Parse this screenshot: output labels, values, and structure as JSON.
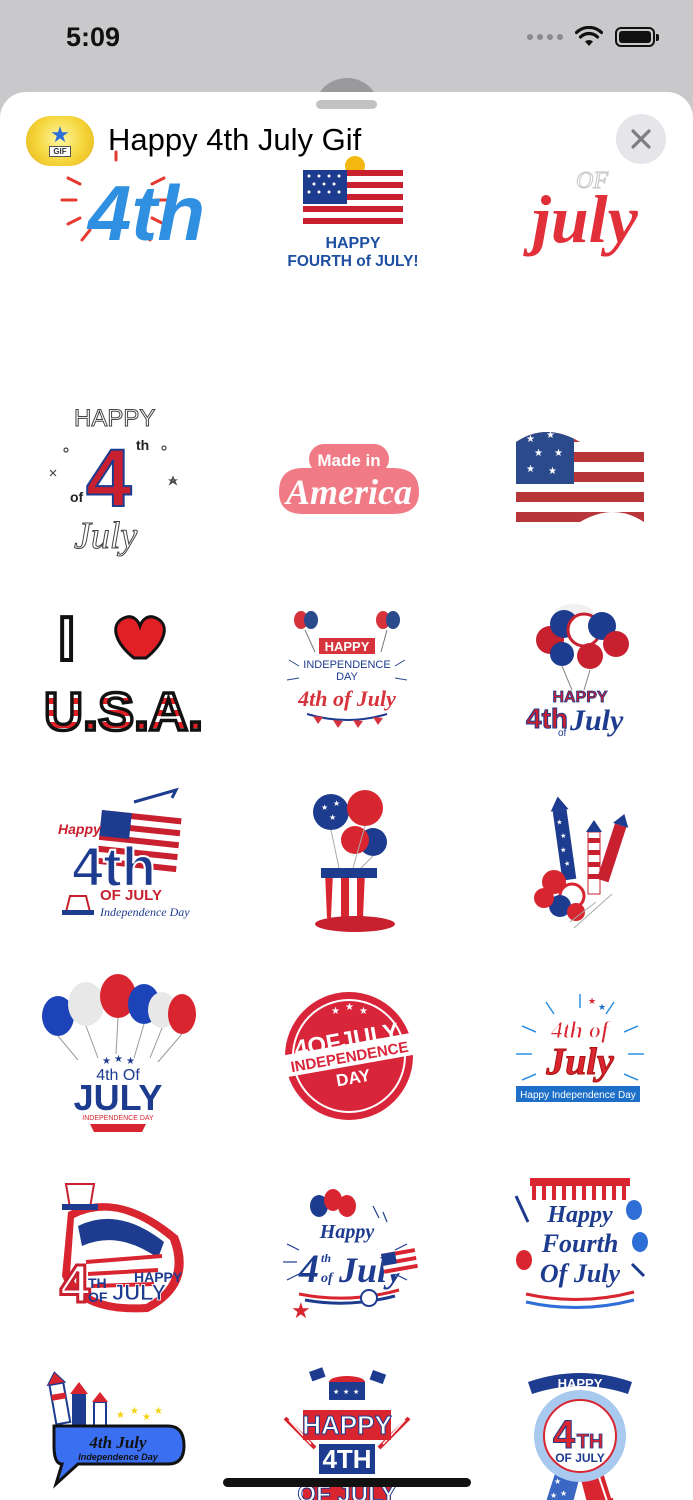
{
  "status_bar": {
    "time": "5:09"
  },
  "header": {
    "title": "Happy 4th July Gif",
    "app_icon_label": "GIF"
  },
  "colors": {
    "red": "#d9252f",
    "blue": "#1d3b8f",
    "light_blue": "#2f8fe0",
    "sheet_bg": "#ffffff",
    "backdrop": "#c9c9cb"
  },
  "stickers": [
    {
      "name": "4th-blue",
      "text": "4th"
    },
    {
      "name": "flag-happy-fourth",
      "line1": "HAPPY",
      "line2": "FOURTH of JULY!"
    },
    {
      "name": "of-july-script",
      "line1": "OF",
      "line2": "july"
    },
    {
      "name": "happy-4th-of-july-outline",
      "line1": "HAPPY",
      "line2": "4",
      "sup": "th",
      "line3": "of",
      "line4": "July"
    },
    {
      "name": "made-in-america",
      "line1": "Made in",
      "line2": "America"
    },
    {
      "name": "waving-flag"
    },
    {
      "name": "i-love-usa",
      "line1": "I",
      "line2": "U.S.A."
    },
    {
      "name": "independence-day-balloons",
      "line1": "HAPPY",
      "line2": "INDEPENDENCE",
      "line3": "DAY",
      "line4": "4th of July"
    },
    {
      "name": "happy-4th-balloons",
      "line1": "HAPPY",
      "line2": "4th",
      "line3": "July",
      "line_of": "of"
    },
    {
      "name": "happy-4th-independence",
      "line1": "Happy",
      "line2": "4th",
      "line3": "OF JULY",
      "line4": "Independence Day"
    },
    {
      "name": "uncle-sam-hat-balloons"
    },
    {
      "name": "fireworks-rockets"
    },
    {
      "name": "balloons-4th-of-july",
      "line1": "4th Of",
      "line2": "JULY",
      "line3": "INDEPENDENCE DAY"
    },
    {
      "name": "4-of-july-stamp",
      "line1": "4OFJULY",
      "line2": "INDEPENDENCE",
      "line3": "DAY"
    },
    {
      "name": "4th-of-july-burst",
      "line1": "4th of",
      "line2": "July",
      "line3": "Happy Independence Day"
    },
    {
      "name": "4th-happy-july-hat",
      "line1": "4",
      "line2": "TH",
      "line3": "OF",
      "line4": "HAPPY",
      "line5": "JULY"
    },
    {
      "name": "happy-4th-of-july-script",
      "line1": "Happy",
      "line2": "4",
      "line3": "th",
      "line4": "of",
      "line5": "July"
    },
    {
      "name": "happy-fourth-of-july",
      "line1": "Happy",
      "line2": "Fourth",
      "line3": "Of July"
    },
    {
      "name": "4th-july-bubble",
      "line1": "4th July",
      "line2": "Independence Day"
    },
    {
      "name": "happy-4th-of-july-drum",
      "line1": "HAPPY",
      "line2": "4TH",
      "line3": "OF JULY"
    },
    {
      "name": "happy-4th-of-july-badge",
      "line1": "HAPPY",
      "line2": "4",
      "line3": "TH",
      "line4": "OF JULY"
    }
  ]
}
